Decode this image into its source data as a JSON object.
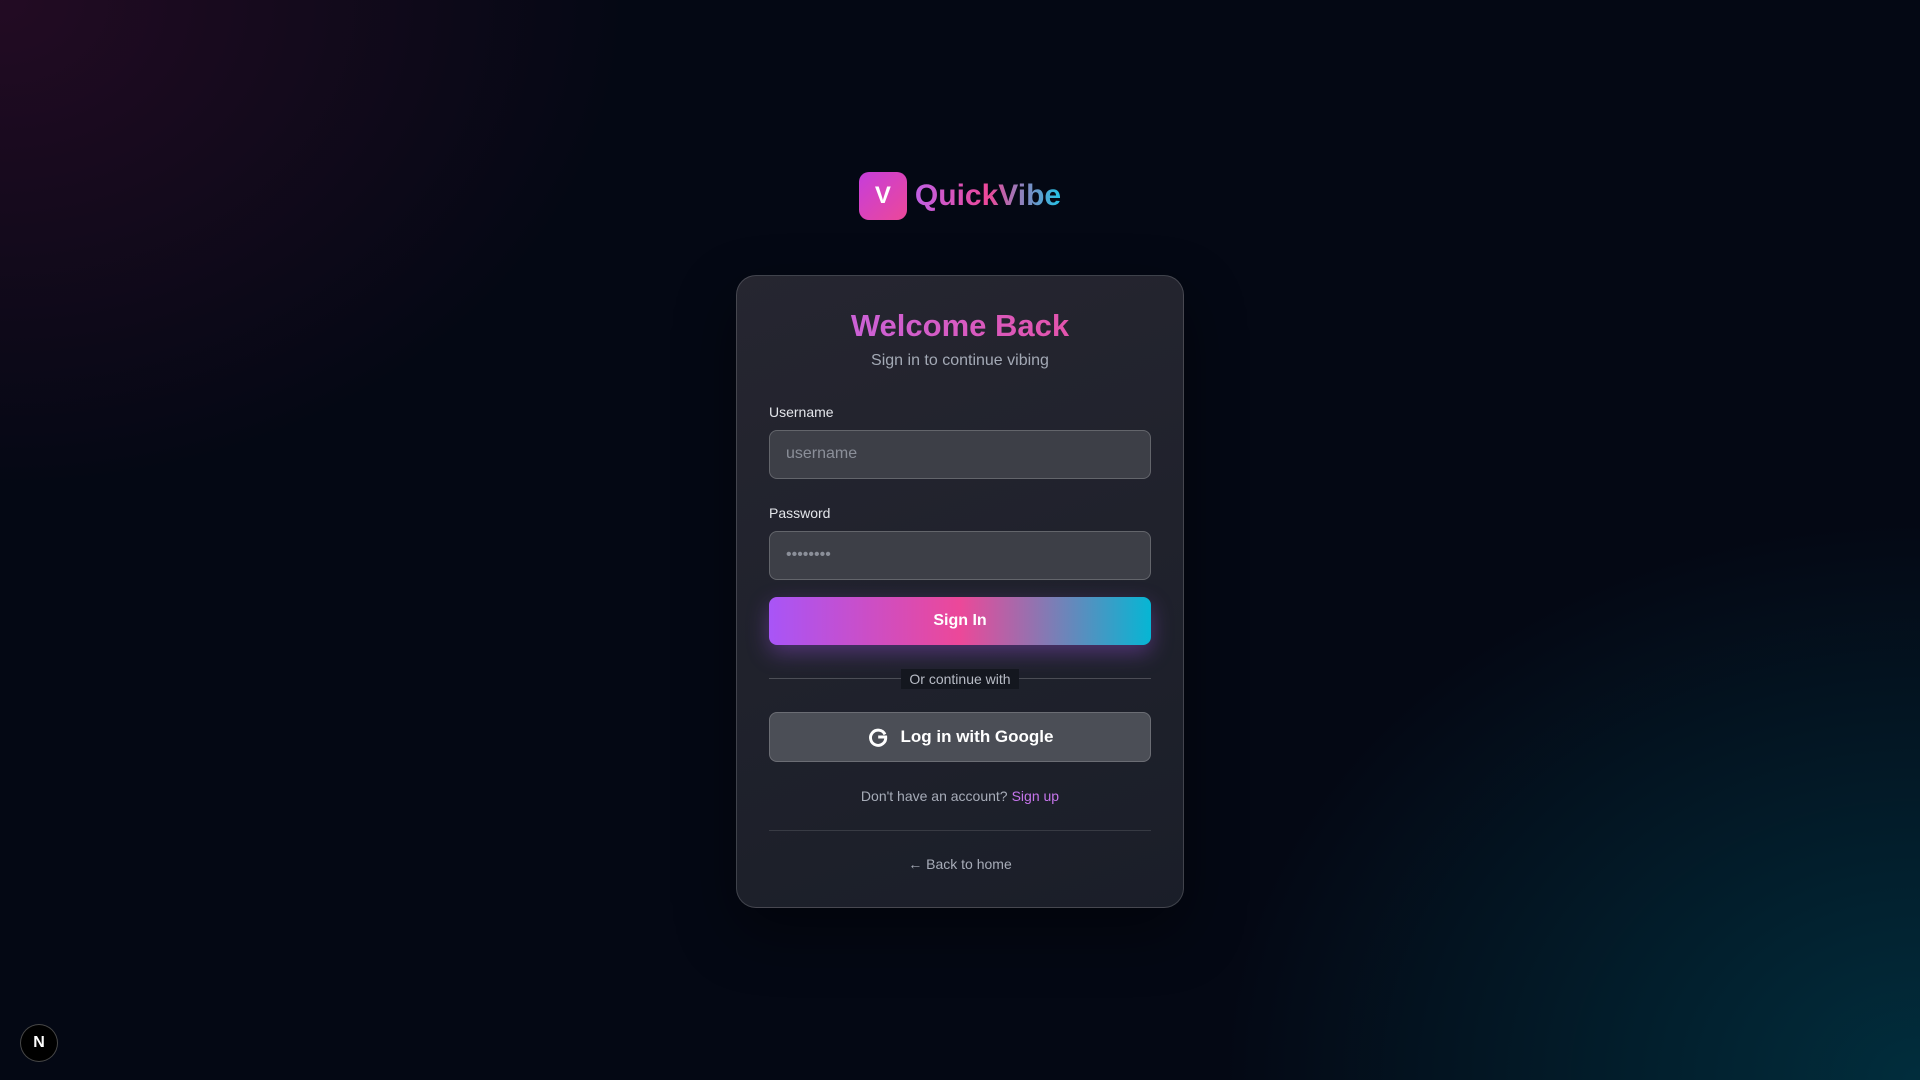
{
  "brand": {
    "badge_letter": "V",
    "name": "QuickVibe"
  },
  "login": {
    "title": "Welcome Back",
    "subtitle": "Sign in to continue vibing",
    "username_label": "Username",
    "username_placeholder": "username",
    "username_value": "",
    "password_label": "Password",
    "password_placeholder": "••••••••",
    "password_value": "",
    "signin_label": "Sign In",
    "divider_text": "Or continue with",
    "google_label": "Log in with Google",
    "google_icon": "google-icon",
    "signup_prompt": "Don't have an account?",
    "signup_link": "Sign up",
    "back_link": "← Back to home"
  },
  "corner_badge": {
    "letter": "N"
  },
  "colors": {
    "background": "#040814",
    "accent_purple": "#a855f7",
    "accent_pink": "#ec4899",
    "accent_cyan": "#06b6d4",
    "link": "#c675ec"
  }
}
